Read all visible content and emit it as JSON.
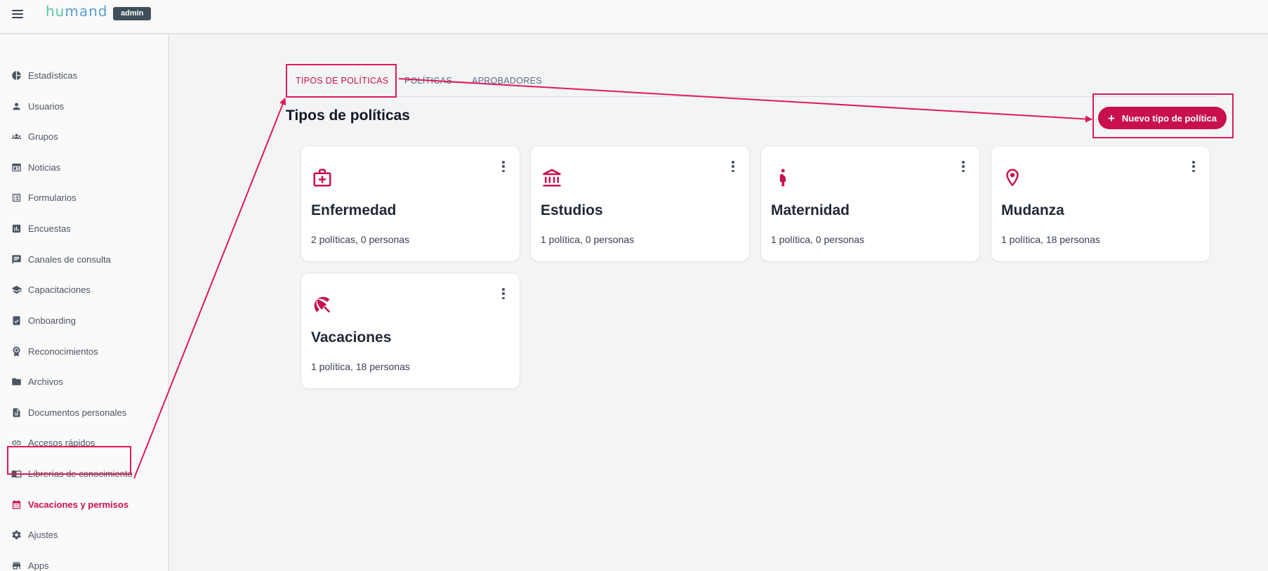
{
  "header": {
    "logo_part1": "hu",
    "logo_part2": "mand",
    "badge": "admin"
  },
  "sidebar": {
    "items": [
      {
        "label": "Estadísticas",
        "icon": "pie-chart-icon"
      },
      {
        "label": "Usuarios",
        "icon": "person-icon"
      },
      {
        "label": "Grupos",
        "icon": "group-icon"
      },
      {
        "label": "Noticias",
        "icon": "newspaper-icon"
      },
      {
        "label": "Formularios",
        "icon": "list-form-icon"
      },
      {
        "label": "Encuestas",
        "icon": "bar-chart-icon"
      },
      {
        "label": "Canales de consulta",
        "icon": "chat-icon"
      },
      {
        "label": "Capacitaciones",
        "icon": "graduation-cap-icon"
      },
      {
        "label": "Onboarding",
        "icon": "checklist-icon"
      },
      {
        "label": "Reconocimientos",
        "icon": "badge-icon"
      },
      {
        "label": "Archivos",
        "icon": "folder-icon"
      },
      {
        "label": "Documentos personales",
        "icon": "document-icon"
      },
      {
        "label": "Accesos rápidos",
        "icon": "link-icon"
      },
      {
        "label": "Librerías de conocimiento",
        "icon": "book-icon"
      },
      {
        "label": "Vacaciones y permisos",
        "icon": "calendar-icon",
        "active": true
      },
      {
        "label": "Ajustes",
        "icon": "gear-icon"
      },
      {
        "label": "Apps",
        "icon": "store-icon"
      }
    ]
  },
  "tabs": [
    {
      "label": "TIPOS DE POLÍTICAS",
      "active": true
    },
    {
      "label": "POLÍTICAS"
    },
    {
      "label": "APROBADORES"
    }
  ],
  "main": {
    "title": "Tipos de políticas",
    "new_button": "Nuevo tipo de política",
    "new_button_icon": "plus-icon"
  },
  "cards": [
    {
      "title": "Enfermedad",
      "subtitle": "2 políticas, 0 personas",
      "icon": "medical-kit-icon"
    },
    {
      "title": "Estudios",
      "subtitle": "1 política, 0 personas",
      "icon": "institution-icon"
    },
    {
      "title": "Maternidad",
      "subtitle": "1 política, 0 personas",
      "icon": "pregnant-icon"
    },
    {
      "title": "Mudanza",
      "subtitle": "1 política, 18 personas",
      "icon": "location-pin-icon"
    },
    {
      "title": "Vacaciones",
      "subtitle": "1 política, 18 personas",
      "icon": "beach-umbrella-icon"
    }
  ],
  "colors": {
    "accent": "#c8104c",
    "annotation": "#e01a55",
    "sidebar_text": "#4b5563",
    "background": "#f3f4f6"
  }
}
